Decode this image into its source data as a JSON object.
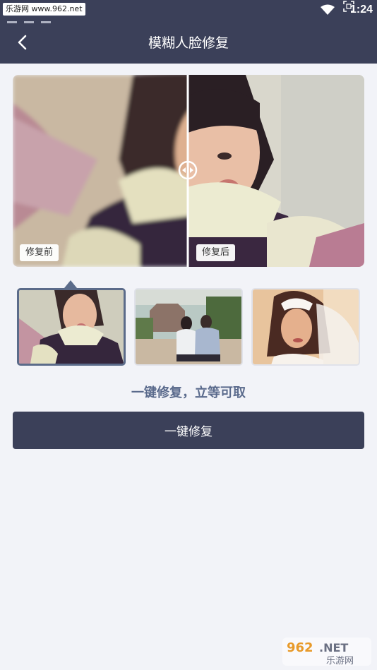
{
  "status_bar": {
    "site_tag": "乐游网 www.962.net",
    "time": "1:24"
  },
  "header": {
    "title": "模糊人脸修复",
    "back_icon": "chevron-left-icon"
  },
  "comparison": {
    "before_label": "修复前",
    "after_label": "修复后",
    "divider_icon": "compare-handle-icon"
  },
  "samples": [
    {
      "name": "child-portrait",
      "selected": true
    },
    {
      "name": "two-women-park",
      "selected": false
    },
    {
      "name": "bride-portrait",
      "selected": false
    }
  ],
  "tagline": "一键修复，立等可取",
  "action_button": "一键修复",
  "watermark": {
    "top": "962.NET",
    "bottom": "乐游网"
  },
  "colors": {
    "header_bg": "#3b4059",
    "accent": "#5a6a8c",
    "page_bg": "#f2f3f8"
  }
}
